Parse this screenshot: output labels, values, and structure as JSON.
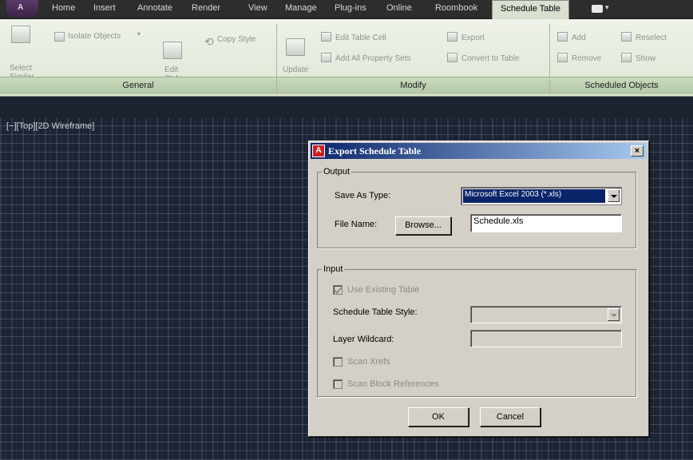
{
  "ribbon": {
    "tabs": [
      "Home",
      "Insert",
      "Annotate",
      "Render",
      "View",
      "Manage",
      "Plug-ins",
      "Online",
      "Roombook",
      "Schedule Table"
    ],
    "active_tab": "Schedule Table",
    "general": {
      "title": "General",
      "select_similar": "Select Similar",
      "isolate_objects": "Isolate Objects",
      "edit_style": "Edit Style",
      "copy_style": "Copy Style"
    },
    "modify": {
      "title": "Modify",
      "update": "Update",
      "edit_table_cell": "Edit Table Cell",
      "add_all_property_sets": "Add All Property Sets",
      "export": "Export",
      "convert_to_table": "Convert to Table"
    },
    "scheduled_objects": {
      "title": "Scheduled Objects",
      "add": "Add",
      "remove": "Remove",
      "reselect": "Reselect",
      "show": "Show"
    }
  },
  "viewport": {
    "label": "[−][Top][2D Wireframe]"
  },
  "dialog": {
    "title": "Export Schedule Table",
    "close": "×",
    "output": {
      "label": "Output",
      "save_as_type_label": "Save As Type:",
      "save_as_type_value": "Microsoft Excel 2003 (*.xls)",
      "file_name_label": "File Name:",
      "browse": "Browse...",
      "file_name_value": "Schedule.xls"
    },
    "input": {
      "label": "Input",
      "use_existing_table": "Use Existing Table",
      "schedule_table_style_label": "Schedule Table Style:",
      "layer_wildcard_label": "Layer Wildcard:",
      "scan_xrefs": "Scan Xrefs",
      "scan_block_references": "Scan Block References"
    },
    "ok": "OK",
    "cancel": "Cancel"
  }
}
